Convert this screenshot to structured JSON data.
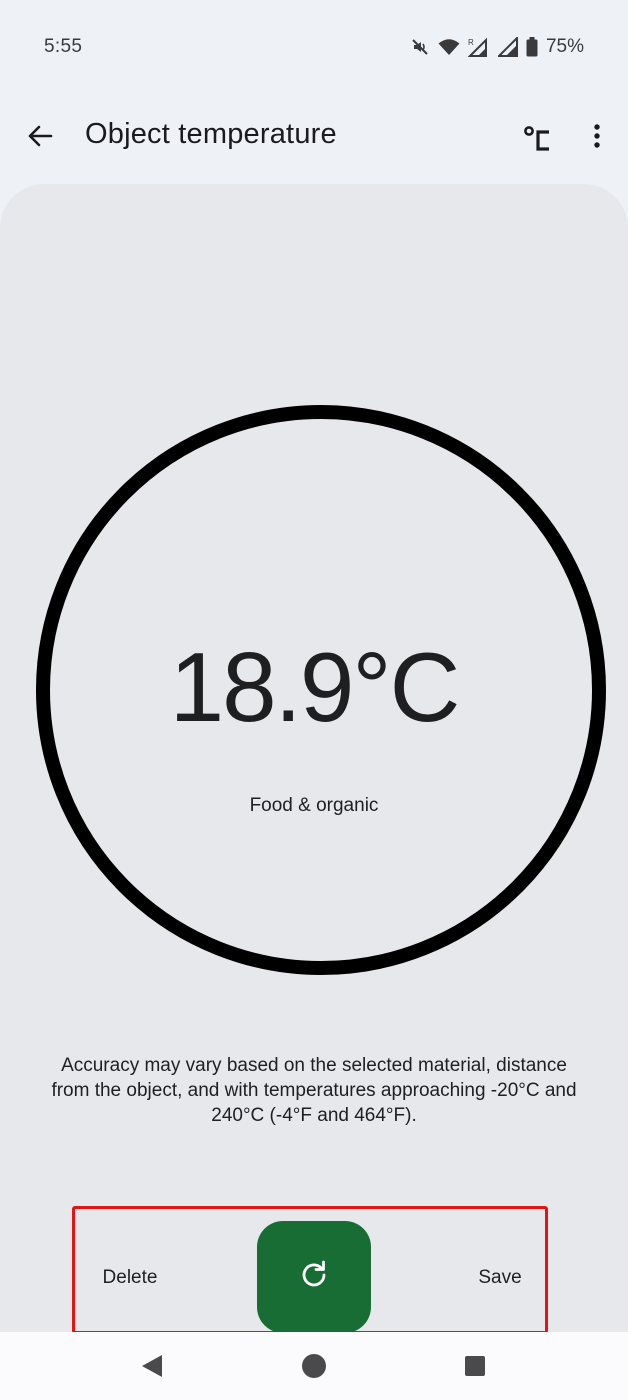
{
  "status_bar": {
    "time": "5:55",
    "battery_percent": "75%",
    "icons": [
      "mute-icon",
      "wifi-icon",
      "signal-roaming-icon",
      "signal-icon",
      "battery-icon"
    ]
  },
  "app_bar": {
    "title": "Object temperature",
    "back_icon": "arrow-back-icon",
    "unit_icon": "celsius-icon",
    "menu_icon": "more-vert-icon"
  },
  "reading": {
    "temperature": "18.9°C",
    "material": "Food & organic"
  },
  "accuracy_note": "Accuracy may vary based on the selected material, distance from the object, and with temperatures approaching -20°C and 240°C (-4°F and 464°F).",
  "actions": {
    "delete_label": "Delete",
    "save_label": "Save",
    "refresh_icon": "refresh-icon"
  },
  "colors": {
    "primary_action": "#176d33",
    "highlight": "#e21414",
    "ring": "#000000",
    "panel": "#e6e8ec",
    "background": "#eef2f7"
  },
  "nav_bar": {
    "icons": [
      "nav-back-icon",
      "nav-home-icon",
      "nav-recents-icon"
    ]
  }
}
